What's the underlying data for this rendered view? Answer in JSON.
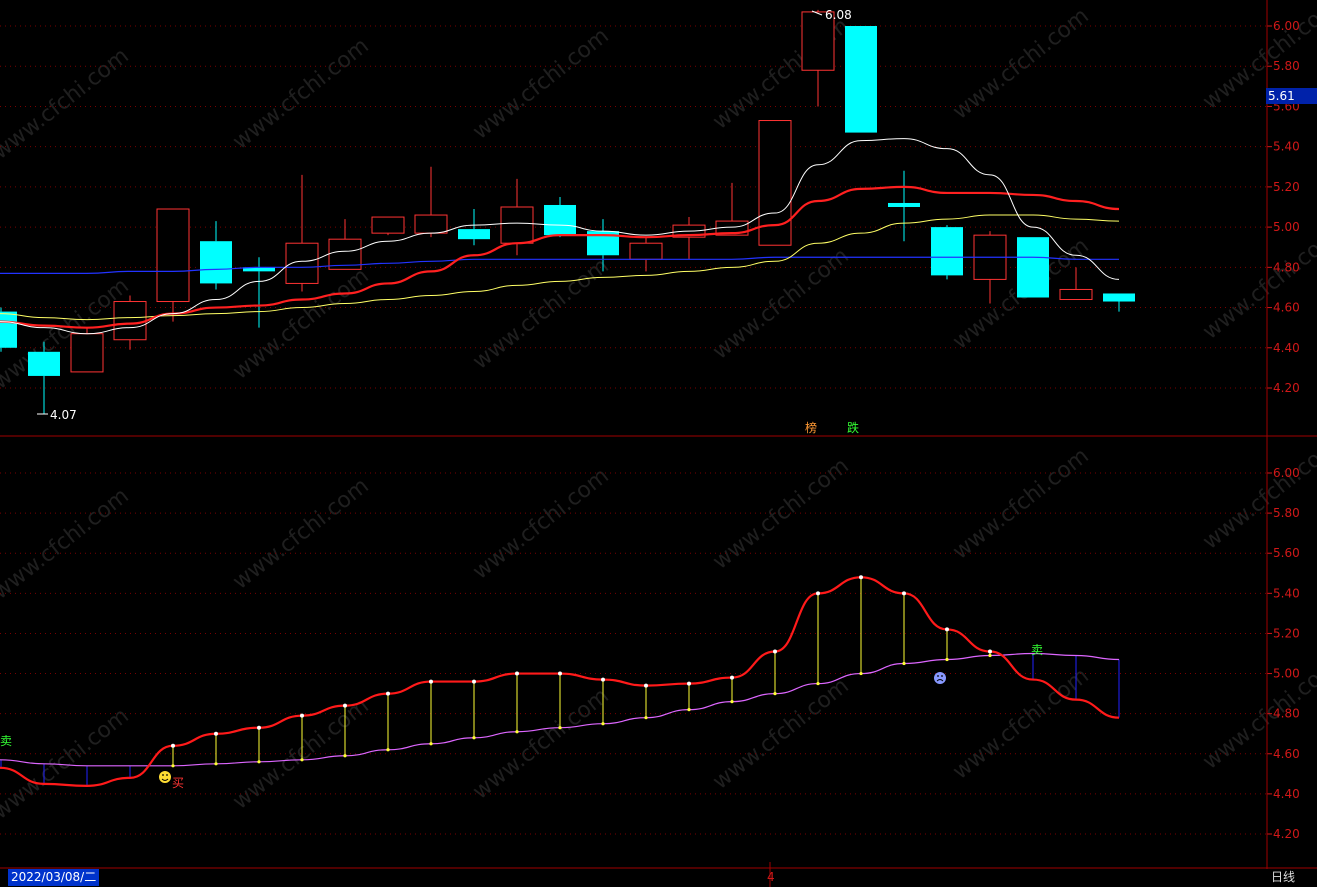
{
  "watermark": "www.cfchi.com",
  "status": {
    "date": "2022/03/08/二",
    "mid_label": "4",
    "period": "日线"
  },
  "current_price": "5.61",
  "colors": {
    "up": "#ff3333",
    "down": "#00ffff",
    "ma5": "#ffffff",
    "ma10": "#ff2020",
    "ma20": "#ffff66",
    "ma60": "#2233ff",
    "axis": "#d01818",
    "lower_fast": "#ff1a1a",
    "lower_slow": "#dd66ff",
    "cross_up": "#ffff33",
    "cross_down": "#2222ff"
  },
  "annotations": {
    "high_label": "6.08",
    "low_label": "4.07",
    "mark1": "榜",
    "mark2": "跌",
    "buy_label": "买",
    "sell_label": "卖",
    "sell_label_left": "卖"
  },
  "chart_data": [
    {
      "type": "candlestick",
      "yticks": [
        "6.00",
        "5.80",
        "5.60",
        "5.40",
        "5.20",
        "5.00",
        "4.80",
        "4.60",
        "4.40",
        "4.20"
      ],
      "ylim": [
        4.0,
        6.1
      ],
      "candles": [
        {
          "o": 4.58,
          "c": 4.4,
          "h": 4.6,
          "l": 4.38
        },
        {
          "o": 4.38,
          "c": 4.26,
          "h": 4.43,
          "l": 4.07
        },
        {
          "o": 4.28,
          "c": 4.47,
          "h": 4.5,
          "l": 4.28
        },
        {
          "o": 4.44,
          "c": 4.63,
          "h": 4.66,
          "l": 4.39
        },
        {
          "o": 4.63,
          "c": 5.09,
          "h": 5.09,
          "l": 4.53
        },
        {
          "o": 4.93,
          "c": 4.72,
          "h": 5.03,
          "l": 4.69
        },
        {
          "o": 4.8,
          "c": 4.78,
          "h": 4.85,
          "l": 4.5
        },
        {
          "o": 4.72,
          "c": 4.92,
          "h": 5.26,
          "l": 4.68
        },
        {
          "o": 4.79,
          "c": 4.94,
          "h": 5.04,
          "l": 4.79
        },
        {
          "o": 4.97,
          "c": 5.05,
          "h": 5.05,
          "l": 4.96
        },
        {
          "o": 4.97,
          "c": 5.06,
          "h": 5.3,
          "l": 4.95
        },
        {
          "o": 4.99,
          "c": 4.94,
          "h": 5.09,
          "l": 4.91
        },
        {
          "o": 4.92,
          "c": 5.1,
          "h": 5.24,
          "l": 4.86
        },
        {
          "o": 5.11,
          "c": 4.96,
          "h": 5.15,
          "l": 4.95
        },
        {
          "o": 4.98,
          "c": 4.86,
          "h": 5.04,
          "l": 4.78
        },
        {
          "o": 4.84,
          "c": 4.92,
          "h": 4.95,
          "l": 4.78
        },
        {
          "o": 4.95,
          "c": 5.01,
          "h": 5.05,
          "l": 4.84
        },
        {
          "o": 4.96,
          "c": 5.03,
          "h": 5.22,
          "l": 4.96
        },
        {
          "o": 4.91,
          "c": 5.53,
          "h": 5.53,
          "l": 4.91
        },
        {
          "o": 5.78,
          "c": 6.07,
          "h": 6.08,
          "l": 5.6
        },
        {
          "o": 6.0,
          "c": 5.47,
          "h": 6.0,
          "l": 5.47
        },
        {
          "o": 5.12,
          "c": 5.1,
          "h": 5.28,
          "l": 4.93
        },
        {
          "o": 5.0,
          "c": 4.76,
          "h": 5.01,
          "l": 4.74
        },
        {
          "o": 4.74,
          "c": 4.96,
          "h": 4.98,
          "l": 4.62
        },
        {
          "o": 4.95,
          "c": 4.65,
          "h": 4.95,
          "l": 4.65
        },
        {
          "o": 4.64,
          "c": 4.69,
          "h": 4.8,
          "l": 4.64
        },
        {
          "o": 4.67,
          "c": 4.63,
          "h": 4.67,
          "l": 4.58
        }
      ],
      "ma5": [
        4.53,
        4.5,
        4.47,
        4.5,
        4.57,
        4.64,
        4.73,
        4.83,
        4.88,
        4.93,
        4.97,
        5.01,
        5.02,
        5.01,
        4.98,
        4.96,
        4.98,
        5.0,
        5.07,
        5.31,
        5.43,
        5.44,
        5.39,
        5.26,
        5.0,
        4.86,
        4.74
      ],
      "ma10": [
        4.53,
        4.51,
        4.5,
        4.52,
        4.57,
        4.6,
        4.61,
        4.64,
        4.67,
        4.72,
        4.78,
        4.86,
        4.92,
        4.96,
        4.96,
        4.95,
        4.96,
        4.97,
        5.01,
        5.13,
        5.19,
        5.2,
        5.17,
        5.17,
        5.16,
        5.13,
        5.09
      ],
      "ma20": [
        4.57,
        4.55,
        4.54,
        4.55,
        4.56,
        4.57,
        4.58,
        4.6,
        4.62,
        4.64,
        4.66,
        4.68,
        4.71,
        4.73,
        4.75,
        4.76,
        4.78,
        4.8,
        4.83,
        4.92,
        4.97,
        5.02,
        5.04,
        5.06,
        5.06,
        5.04,
        5.03
      ],
      "ma60": [
        4.77,
        4.77,
        4.77,
        4.78,
        4.78,
        4.79,
        4.8,
        4.8,
        4.81,
        4.82,
        4.83,
        4.84,
        4.84,
        4.84,
        4.84,
        4.84,
        4.84,
        4.84,
        4.85,
        4.85,
        4.85,
        4.85,
        4.85,
        4.85,
        4.85,
        4.84,
        4.84
      ]
    },
    {
      "type": "line",
      "yticks": [
        "6.00",
        "5.80",
        "5.60",
        "5.40",
        "5.20",
        "5.00",
        "4.80",
        "4.60",
        "4.40",
        "4.20"
      ],
      "ylim": [
        4.1,
        6.1
      ],
      "fast": [
        4.53,
        4.45,
        4.44,
        4.48,
        4.64,
        4.7,
        4.73,
        4.79,
        4.84,
        4.9,
        4.96,
        4.96,
        5.0,
        5.0,
        4.97,
        4.94,
        4.95,
        4.98,
        5.11,
        5.4,
        5.48,
        5.4,
        5.22,
        5.11,
        4.97,
        4.87,
        4.78
      ],
      "slow": [
        4.57,
        4.55,
        4.54,
        4.54,
        4.54,
        4.55,
        4.56,
        4.57,
        4.59,
        4.62,
        4.65,
        4.68,
        4.71,
        4.73,
        4.75,
        4.78,
        4.82,
        4.86,
        4.9,
        4.95,
        5.0,
        5.05,
        5.07,
        5.09,
        5.1,
        5.09,
        5.07
      ]
    }
  ]
}
